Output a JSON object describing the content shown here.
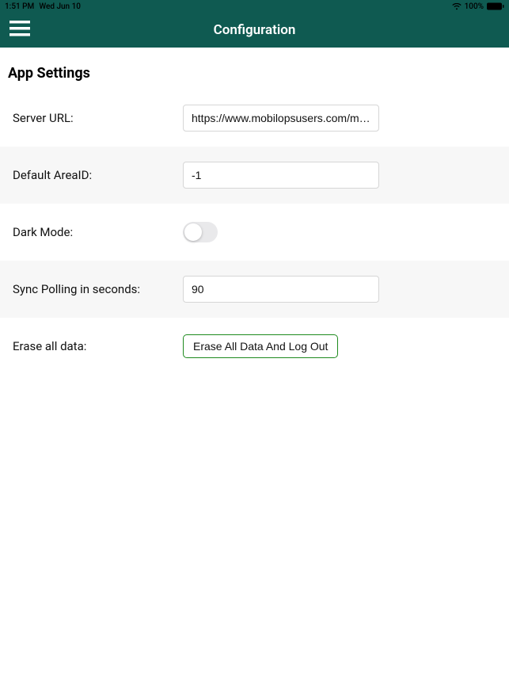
{
  "status": {
    "time": "1:51 PM",
    "date": "Wed Jun 10",
    "battery_pct": "100%"
  },
  "header": {
    "title": "Configuration"
  },
  "page": {
    "heading": "App Settings"
  },
  "fields": {
    "server_url": {
      "label": "Server URL:",
      "value": "https://www.mobilopsusers.com/m…"
    },
    "area_id": {
      "label": "Default AreaID:",
      "value": "-1"
    },
    "dark_mode": {
      "label": "Dark Mode:"
    },
    "sync_poll": {
      "label": "Sync Polling in seconds:",
      "value": "90"
    },
    "erase": {
      "label": "Erase all data:",
      "button": "Erase All Data And Log Out"
    }
  }
}
